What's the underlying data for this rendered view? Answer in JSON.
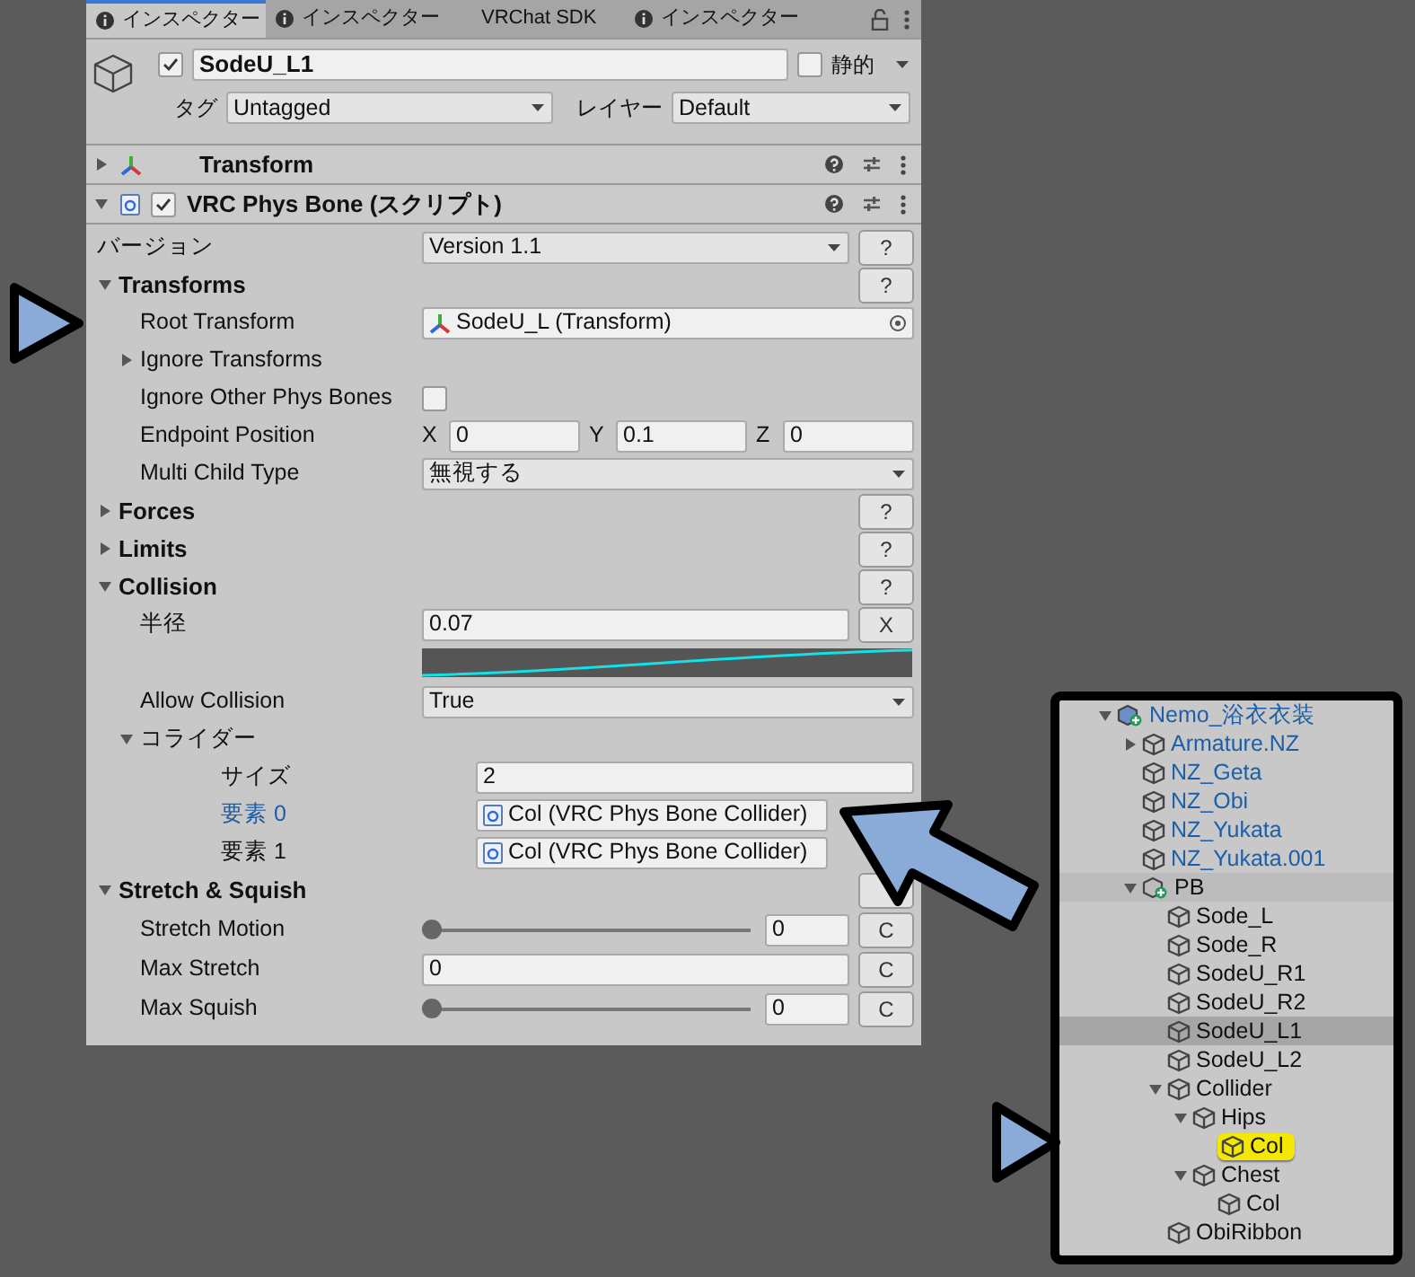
{
  "tabs": [
    {
      "label": "インスペクター",
      "info_icon": true,
      "selected": true
    },
    {
      "label": "インスペクター",
      "info_icon": true,
      "selected": false
    },
    {
      "label": "VRChat SDK",
      "info_icon": false,
      "selected": false
    },
    {
      "label": "インスペクター",
      "info_icon": true,
      "selected": false
    }
  ],
  "object": {
    "active": true,
    "name": "SodeU_L1",
    "static": false,
    "static_label": "静的",
    "tag_label": "タグ",
    "tag": "Untagged",
    "layer_label": "レイヤー",
    "layer": "Default"
  },
  "components": [
    {
      "kind": "transform",
      "name": "Transform",
      "expanded": false
    },
    {
      "kind": "script",
      "name": "VRC Phys Bone (スクリプト)",
      "expanded": true,
      "enabled": true
    }
  ],
  "properties": [
    {
      "kind": "dropdown",
      "label": "バージョン",
      "value": "Version 1.1",
      "button": "?"
    },
    {
      "kind": "section",
      "label": "Transforms",
      "expanded": true,
      "button": "?",
      "children": [
        {
          "kind": "transform_field",
          "label": "Root Transform",
          "value": "SodeU_L (Transform)",
          "selected": false
        },
        {
          "kind": "foldout",
          "label": "Ignore Transforms",
          "expanded": false
        },
        {
          "kind": "checkbox",
          "label": "Ignore Other Phys Bones",
          "checked": false
        },
        {
          "kind": "vector3",
          "label": "Endpoint Position",
          "values": [
            {
              "axis": "X",
              "value": "0"
            },
            {
              "axis": "Y",
              "value": "0.1"
            },
            {
              "axis": "Z",
              "value": "0"
            }
          ]
        },
        {
          "kind": "dropdown",
          "label": "Multi Child Type",
          "value": "無視する"
        }
      ]
    },
    {
      "kind": "section",
      "label": "Forces",
      "expanded": false,
      "button": "?"
    },
    {
      "kind": "section",
      "label": "Limits",
      "expanded": false,
      "button": "?"
    },
    {
      "kind": "section",
      "label": "Collision",
      "expanded": true,
      "button": "?",
      "children": [
        {
          "kind": "float",
          "label": "半径",
          "value": "0.07",
          "button": "X"
        },
        {
          "kind": "curve"
        },
        {
          "kind": "dropdown",
          "label": "Allow Collision",
          "value": "True"
        },
        {
          "kind": "foldout",
          "label": "コライダー",
          "expanded": true,
          "children": [
            {
              "kind": "float",
              "label": "サイズ",
              "value": "2"
            },
            {
              "kind": "component_field",
              "label": "要素 0",
              "value": "Col (VRC Phys Bone Collider)",
              "selected": true
            },
            {
              "kind": "component_field",
              "label": "要素 1",
              "value": "Col (VRC Phys Bone Collider)",
              "selected": false
            }
          ]
        }
      ]
    },
    {
      "kind": "section",
      "label": "Stretch & Squish",
      "expanded": true,
      "children": [
        {
          "kind": "slider",
          "label": "Stretch Motion",
          "level": 0,
          "value": "0",
          "button": "C"
        },
        {
          "kind": "float",
          "label": "Max Stretch",
          "value": "0",
          "button": "C"
        },
        {
          "kind": "slider",
          "label": "Max Squish",
          "level": 0,
          "value": "0",
          "button": "C"
        }
      ]
    }
  ],
  "hierarchy": {
    "items": [
      {
        "kind": "prefab_root",
        "label": "Nemo_浴衣衣装",
        "prefab": true,
        "expanded": true,
        "selected": false,
        "hovered": false,
        "pinged": false,
        "children": [
          {
            "kind": "object",
            "label": "Armature.NZ",
            "prefab": true,
            "expanded": false,
            "selected": false,
            "hovered": false,
            "pinged": false
          },
          {
            "kind": "object",
            "label": "NZ_Geta",
            "prefab": true,
            "selected": false,
            "hovered": false,
            "pinged": false
          },
          {
            "kind": "object",
            "label": "NZ_Obi",
            "prefab": true,
            "selected": false,
            "hovered": false,
            "pinged": false
          },
          {
            "kind": "object",
            "label": "NZ_Yukata",
            "prefab": true,
            "selected": false,
            "hovered": false,
            "pinged": false
          },
          {
            "kind": "object",
            "label": "NZ_Yukata.001",
            "prefab": true,
            "selected": false,
            "hovered": false,
            "pinged": false
          },
          {
            "kind": "added_object",
            "label": "PB",
            "prefab": false,
            "expanded": true,
            "selected": false,
            "hovered": true,
            "pinged": false,
            "children": [
              {
                "kind": "object",
                "label": "Sode_L",
                "prefab": false,
                "selected": false,
                "hovered": false,
                "pinged": false
              },
              {
                "kind": "object",
                "label": "Sode_R",
                "prefab": false,
                "selected": false,
                "hovered": false,
                "pinged": false
              },
              {
                "kind": "object",
                "label": "SodeU_R1",
                "prefab": false,
                "selected": false,
                "hovered": false,
                "pinged": false
              },
              {
                "kind": "object",
                "label": "SodeU_R2",
                "prefab": false,
                "selected": false,
                "hovered": false,
                "pinged": false
              },
              {
                "kind": "object",
                "label": "SodeU_L1",
                "prefab": false,
                "selected": true,
                "hovered": false,
                "pinged": false
              },
              {
                "kind": "object",
                "label": "SodeU_L2",
                "prefab": false,
                "selected": false,
                "hovered": false,
                "pinged": false
              },
              {
                "kind": "object",
                "label": "Collider",
                "prefab": false,
                "expanded": true,
                "selected": false,
                "hovered": false,
                "pinged": false,
                "children": [
                  {
                    "kind": "object",
                    "label": "Hips",
                    "prefab": false,
                    "expanded": true,
                    "selected": false,
                    "hovered": false,
                    "pinged": false,
                    "children": [
                      {
                        "kind": "object",
                        "label": "Col",
                        "prefab": false,
                        "selected": false,
                        "hovered": false,
                        "pinged": true
                      }
                    ]
                  },
                  {
                    "kind": "object",
                    "label": "Chest",
                    "prefab": false,
                    "expanded": true,
                    "selected": false,
                    "hovered": false,
                    "pinged": false,
                    "children": [
                      {
                        "kind": "object",
                        "label": "Col",
                        "prefab": false,
                        "selected": false,
                        "hovered": false,
                        "pinged": false
                      }
                    ]
                  }
                ]
              },
              {
                "kind": "object",
                "label": "ObiRibbon",
                "prefab": false,
                "selected": false,
                "hovered": false,
                "pinged": false
              }
            ]
          }
        ]
      }
    ]
  }
}
